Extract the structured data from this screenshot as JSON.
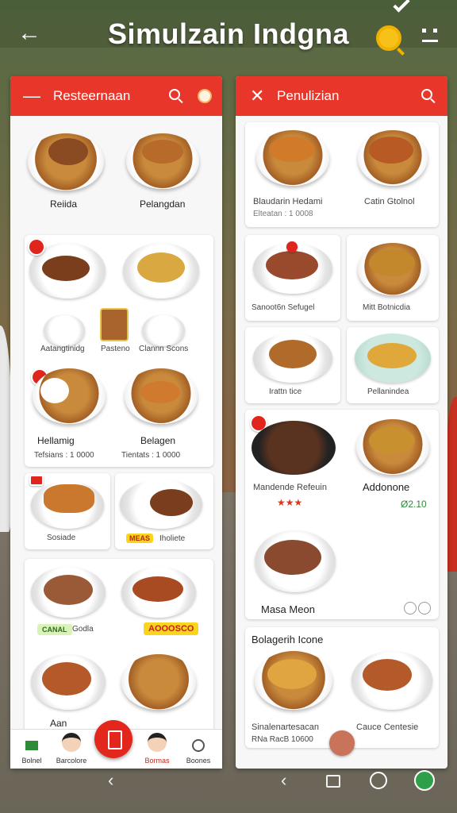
{
  "app": {
    "title": "Simulzain Indgna",
    "back_icon": "back-arrow-icon",
    "search_icon": "search-icon",
    "menu_icon": "grid-menu-icon"
  },
  "left_panel": {
    "header_title": "Resteernaan",
    "items": {
      "r1_left": "Reiida",
      "r1_right": "Pelangdan",
      "small_a": "Aatangtinidg",
      "small_b": "Pasteno",
      "small_c": "Clannn Scons",
      "r3_left": "Hellamig",
      "r3_left_price": "Tefsians : 1 0000",
      "r3_right": "Belagen",
      "r3_right_price": "Tientats : 1 0000",
      "r4_left": "Sosiade",
      "r4_right_tag": "MEAS",
      "r4_right": "Iholiete",
      "r5_left_tag": "CANAL",
      "r5_left": "Godla",
      "r5_right_tag": "AOOOSCO",
      "r6_left": "Aan"
    },
    "bottom_nav": {
      "home_label": "Bolnel",
      "profile_label": "Barcolore",
      "chef_label": "Bormas",
      "more_label": "Boones"
    }
  },
  "right_panel": {
    "header_title": "Penulizian",
    "items": {
      "c1_left": "Blaudarin Hedami",
      "c1_left_sub": "Elteatan : 1 0008",
      "c1_right": "Catin Gtolnol",
      "c2_left": "Sanoot6n Sefugel",
      "c2_right": "Mitt Botnicdia",
      "c3_left": "Irattn tice",
      "c3_right": "Pellanindea",
      "c4_left": "Mandende Refeuin",
      "c4_rating": "★★★",
      "c4_right": "Addonone",
      "c4_right_price": "Ø2.10",
      "c5_left": "Masa Meon",
      "c6_title": "Bolagerih Icone",
      "c6_left": "Sinalenartesacan",
      "c6_left_sub": "RNa RacB 10600",
      "c6_right": "Cauce Centesie"
    }
  },
  "colors": {
    "accent_red": "#e8372a",
    "yellow": "#f6c21a",
    "green": "#2ea04a"
  }
}
